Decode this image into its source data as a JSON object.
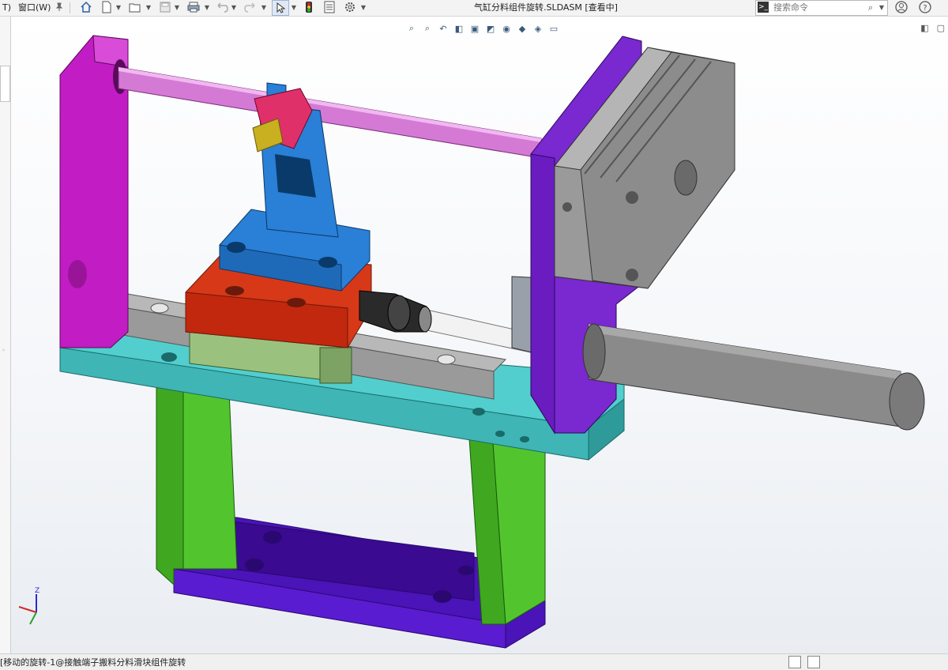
{
  "window": {
    "title": "气缸分料组件旋转.SLDASM [查看中]"
  },
  "menu": {
    "truncated_item": "T)",
    "window_item": "窗口(W)"
  },
  "toolbar": {
    "icons": [
      "pin-icon",
      "home-icon",
      "new-document-icon",
      "open-folder-icon",
      "save-icon",
      "print-icon",
      "undo-icon",
      "redo-icon",
      "select-arrow-icon",
      "traffic-light-icon",
      "file-properties-icon",
      "options-gear-icon"
    ]
  },
  "search": {
    "placeholder": "搜索命令"
  },
  "help": {
    "icons": [
      "user-account-icon",
      "help-icon"
    ]
  },
  "headsup": {
    "icons": [
      "zoom-to-fit-icon",
      "zoom-to-area-icon",
      "previous-view-icon",
      "section-view-icon",
      "view-orientation-icon",
      "display-style-icon",
      "hide-show-items-icon",
      "edit-appearance-icon",
      "apply-scene-icon",
      "view-settings-icon"
    ]
  },
  "statusbar": {
    "text": "[移动的旋转-1@接触端子搬料分料滑块组件旋转"
  },
  "triad": {
    "z_label": "Z"
  },
  "colors": {
    "magenta_plate": "#c21cc4",
    "cyan_base": "#3fbcbc",
    "green_legs": "#4fbf2e",
    "purple_bottom": "#4a14b8",
    "red_block": "#cc2a10",
    "blue_block": "#2a7fd6",
    "sage_slider": "#86b26a",
    "violet_plate": "#7a28d0",
    "gray_cylinder": "#8a8a8a"
  }
}
